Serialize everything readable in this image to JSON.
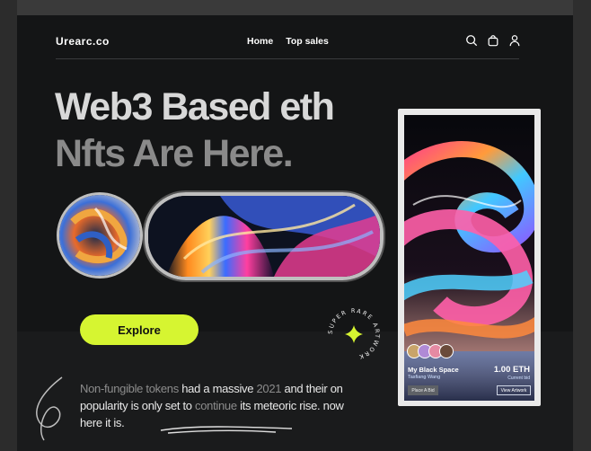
{
  "brand": {
    "logo": "Urearc.co"
  },
  "nav": {
    "items": [
      "Home",
      "Top sales"
    ]
  },
  "header_icons": [
    "search-icon",
    "bag-icon",
    "user-icon"
  ],
  "hero": {
    "line1": "Web3 Based eth",
    "line2": "Nfts Are Here.",
    "cta": "Explore",
    "badge_text": "SUPER RARE ARTWORK"
  },
  "description": {
    "p1": "Non-fungible tokens",
    "p2": " had a massive ",
    "p3": "2021",
    "p4": " and their on popularity is only set to ",
    "p5": "continue",
    "p6": " its meteoric rise. now here it is."
  },
  "card": {
    "title": "My Black Space",
    "artist": "Tasfiang Wang",
    "price": "1.00 ETH",
    "price_sub": "Current bid",
    "bid_button": "Place A Bid",
    "view_button": "View Artwork"
  },
  "colors": {
    "accent": "#d6f531",
    "background": "#141516"
  }
}
